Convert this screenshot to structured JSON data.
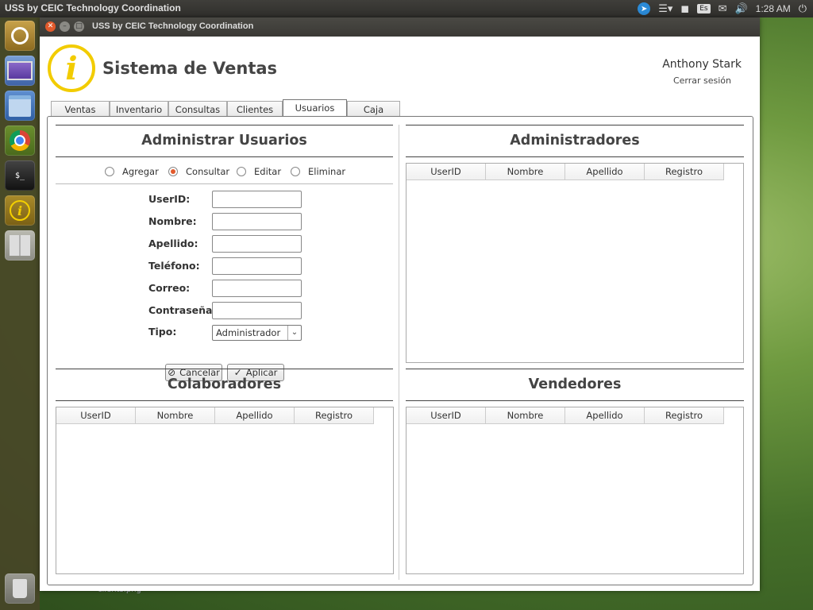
{
  "topbar": {
    "title": "USS by CEIC Technology Coordination",
    "keyboard_layout": "Es",
    "clock": "1:28 AM"
  },
  "launcher": {
    "items": [
      "ubuntu-dash-icon",
      "screenshot-app-icon",
      "files-icon",
      "chrome-icon",
      "terminal-icon",
      "sistema-ventas-icon",
      "workspaces-icon",
      "trash-icon"
    ]
  },
  "window": {
    "title": "USS by CEIC Technology Coordination",
    "app_title": "Sistema de Ventas",
    "user_name": "Anthony Stark",
    "logout_label": "Cerrar sesión"
  },
  "tabs": [
    {
      "label": "Ventas"
    },
    {
      "label": "Inventario"
    },
    {
      "label": "Consultas"
    },
    {
      "label": "Clientes"
    },
    {
      "label": "Usuarios"
    },
    {
      "label": "Caja"
    }
  ],
  "active_tab": "Usuarios",
  "admin_panel": {
    "title": "Administrar Usuarios",
    "modes": [
      {
        "label": "Agregar",
        "selected": false
      },
      {
        "label": "Consultar",
        "selected": true
      },
      {
        "label": "Editar",
        "selected": false
      },
      {
        "label": "Eliminar",
        "selected": false
      }
    ],
    "fields": {
      "userid": {
        "label": "UserID:",
        "value": ""
      },
      "nombre": {
        "label": "Nombre:",
        "value": ""
      },
      "apellido": {
        "label": "Apellido:",
        "value": ""
      },
      "telefono": {
        "label": "Teléfono:",
        "value": ""
      },
      "correo": {
        "label": "Correo:",
        "value": ""
      },
      "contrasena": {
        "label": "Contraseña:",
        "value": ""
      },
      "tipo": {
        "label": "Tipo:",
        "value": "Administrador"
      }
    },
    "cancel_label": "Cancelar",
    "apply_label": "Aplicar"
  },
  "table_columns": [
    "UserID",
    "Nombre",
    "Apellido",
    "Registro"
  ],
  "administradores": {
    "title": "Administradores"
  },
  "colaboradores": {
    "title": "Colaboradores"
  },
  "vendedores": {
    "title": "Vendedores"
  },
  "desktop": {
    "file_label": "clients.png"
  },
  "colors": {
    "accent_radio": "#e25a2c",
    "logo_yellow": "#f2cc00",
    "close_button": "#e25a2c"
  }
}
